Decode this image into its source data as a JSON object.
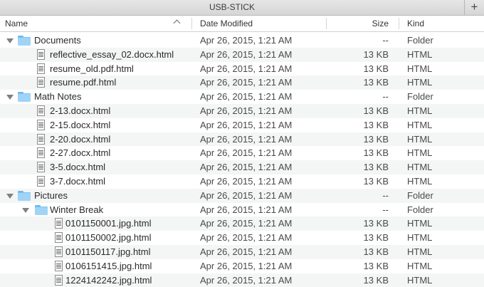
{
  "window": {
    "title": "USB-STICK",
    "new_tab_icon": "plus-icon",
    "new_tab_label": "+"
  },
  "columns": {
    "name": "Name",
    "date": "Date Modified",
    "size": "Size",
    "kind": "Kind",
    "sort": "name-ascending"
  },
  "icons": {
    "folder": "folder-icon",
    "file": "html-document-icon",
    "disclosure": "disclosure-triangle-icon"
  },
  "rows": [
    {
      "type": "folder",
      "depth": 0,
      "expanded": true,
      "name": "Documents",
      "date": "Apr 26, 2015, 1:21 AM",
      "size": "--",
      "kind": "Folder"
    },
    {
      "type": "file",
      "depth": 1,
      "name": "reflective_essay_02.docx.html",
      "date": "Apr 26, 2015, 1:21 AM",
      "size": "13 KB",
      "kind": "HTML"
    },
    {
      "type": "file",
      "depth": 1,
      "name": "resume_old.pdf.html",
      "date": "Apr 26, 2015, 1:21 AM",
      "size": "13 KB",
      "kind": "HTML"
    },
    {
      "type": "file",
      "depth": 1,
      "name": "resume.pdf.html",
      "date": "Apr 26, 2015, 1:21 AM",
      "size": "13 KB",
      "kind": "HTML"
    },
    {
      "type": "folder",
      "depth": 0,
      "expanded": true,
      "name": "Math Notes",
      "date": "Apr 26, 2015, 1:21 AM",
      "size": "--",
      "kind": "Folder"
    },
    {
      "type": "file",
      "depth": 1,
      "name": "2-13.docx.html",
      "date": "Apr 26, 2015, 1:21 AM",
      "size": "13 KB",
      "kind": "HTML"
    },
    {
      "type": "file",
      "depth": 1,
      "name": "2-15.docx.html",
      "date": "Apr 26, 2015, 1:21 AM",
      "size": "13 KB",
      "kind": "HTML"
    },
    {
      "type": "file",
      "depth": 1,
      "name": "2-20.docx.html",
      "date": "Apr 26, 2015, 1:21 AM",
      "size": "13 KB",
      "kind": "HTML"
    },
    {
      "type": "file",
      "depth": 1,
      "name": "2-27.docx.html",
      "date": "Apr 26, 2015, 1:21 AM",
      "size": "13 KB",
      "kind": "HTML"
    },
    {
      "type": "file",
      "depth": 1,
      "name": "3-5.docx.html",
      "date": "Apr 26, 2015, 1:21 AM",
      "size": "13 KB",
      "kind": "HTML"
    },
    {
      "type": "file",
      "depth": 1,
      "name": "3-7.docx.html",
      "date": "Apr 26, 2015, 1:21 AM",
      "size": "13 KB",
      "kind": "HTML"
    },
    {
      "type": "folder",
      "depth": 0,
      "expanded": true,
      "name": "Pictures",
      "date": "Apr 26, 2015, 1:21 AM",
      "size": "--",
      "kind": "Folder"
    },
    {
      "type": "folder",
      "depth": 1,
      "expanded": true,
      "name": "Winter Break",
      "date": "Apr 26, 2015, 1:21 AM",
      "size": "--",
      "kind": "Folder"
    },
    {
      "type": "file",
      "depth": 2,
      "name": "0101150001.jpg.html",
      "date": "Apr 26, 2015, 1:21 AM",
      "size": "13 KB",
      "kind": "HTML"
    },
    {
      "type": "file",
      "depth": 2,
      "name": "0101150002.jpg.html",
      "date": "Apr 26, 2015, 1:21 AM",
      "size": "13 KB",
      "kind": "HTML"
    },
    {
      "type": "file",
      "depth": 2,
      "name": "0101150117.jpg.html",
      "date": "Apr 26, 2015, 1:21 AM",
      "size": "13 KB",
      "kind": "HTML"
    },
    {
      "type": "file",
      "depth": 2,
      "name": "0106151415.jpg.html",
      "date": "Apr 26, 2015, 1:21 AM",
      "size": "13 KB",
      "kind": "HTML"
    },
    {
      "type": "file",
      "depth": 2,
      "name": "1224142242.jpg.html",
      "date": "Apr 26, 2015, 1:21 AM",
      "size": "13 KB",
      "kind": "HTML"
    }
  ]
}
